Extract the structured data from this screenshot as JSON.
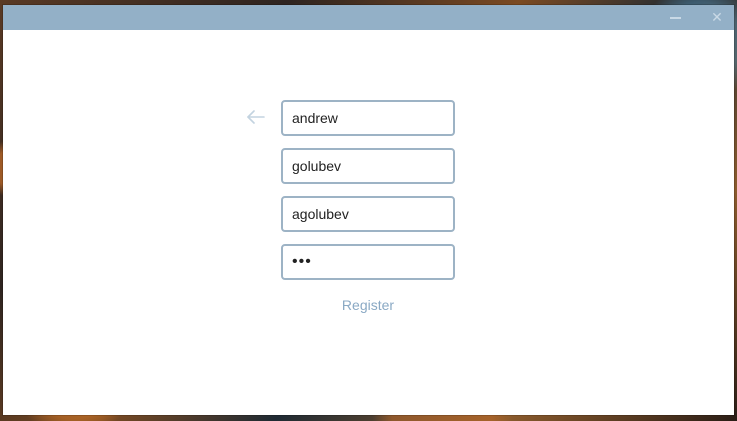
{
  "window": {
    "minimize_icon": "minimize-icon",
    "close_icon": "close-icon",
    "close_glyph": "✕"
  },
  "form": {
    "back_icon": "arrow-left-icon",
    "first_name": "andrew",
    "last_name": "golubev",
    "username": "agolubev",
    "password": "•••",
    "register_label": "Register"
  },
  "colors": {
    "titlebar": "#93b0c7",
    "field_border": "#9db3c5",
    "link": "#8aa9c4"
  }
}
